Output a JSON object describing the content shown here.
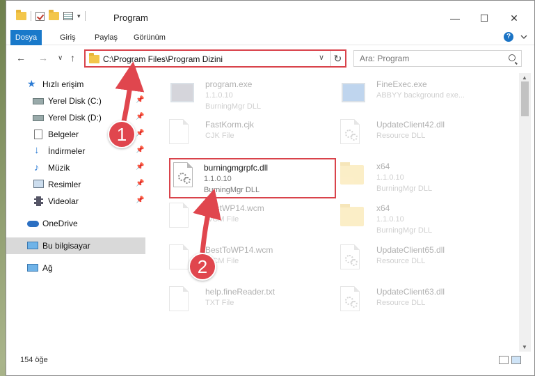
{
  "window": {
    "title": "Program",
    "minimize": "—",
    "maximize": "☐",
    "close": "✕"
  },
  "ribbon": {
    "tabs": [
      "Dosya",
      "Giriş",
      "Paylaş",
      "Görünüm"
    ],
    "help": "?"
  },
  "address": {
    "path": "C:\\Program Files\\Program Dizini",
    "dropdown": "∨",
    "refresh": "↻"
  },
  "search": {
    "placeholder": "Ara: Program"
  },
  "nav": {
    "back": "←",
    "forward": "→",
    "recent": "∨",
    "up": "↑",
    "items": [
      {
        "label": "Hızlı erişim",
        "icon": "star-icon"
      },
      {
        "label": "Yerel Disk (C:)",
        "icon": "drive-icon",
        "pinned": true
      },
      {
        "label": "Yerel Disk (D:)",
        "icon": "drive-icon",
        "pinned": true
      },
      {
        "label": "Belgeler",
        "icon": "documents-icon",
        "pinned": true
      },
      {
        "label": "İndirmeler",
        "icon": "download-icon",
        "pinned": true
      },
      {
        "label": "Müzik",
        "icon": "music-icon",
        "pinned": true
      },
      {
        "label": "Resimler",
        "icon": "pictures-icon",
        "pinned": true
      },
      {
        "label": "Videolar",
        "icon": "video-icon",
        "pinned": true
      },
      {
        "label": "OneDrive",
        "icon": "cloud-icon"
      },
      {
        "label": "Bu bilgisayar",
        "icon": "computer-icon",
        "selected": true
      },
      {
        "label": "Ağ",
        "icon": "network-icon"
      }
    ]
  },
  "files": [
    {
      "name": "program.exe",
      "line2": "1.1.0.10",
      "line3": "BurningMgr DLL",
      "icon": "exe-icon"
    },
    {
      "name": "FineExec.exe",
      "line2": "ABBYY background exe...",
      "line3": "",
      "icon": "exe-icon"
    },
    {
      "name": "FastKorm.cjk",
      "line2": "CJK File",
      "line3": "",
      "icon": "file-icon"
    },
    {
      "name": "UpdateClient42.dll",
      "line2": "Resource DLL",
      "line3": "",
      "icon": "dll-icon"
    },
    {
      "name": "burningmgrpfc.dll",
      "line2": "1.1.0.10",
      "line3": "BurningMgr DLL",
      "icon": "dll-icon"
    },
    {
      "name": "x64",
      "line2": "1.1.0.10",
      "line3": "BurningMgr DLL",
      "icon": "folder-icon"
    },
    {
      "name": "BestWP14.wcm",
      "line2": "WCM File",
      "line3": "",
      "icon": "file-icon"
    },
    {
      "name": "x64",
      "line2": "1.1.0.10",
      "line3": "BurningMgr DLL",
      "icon": "folder-icon"
    },
    {
      "name": "BestToWP14.wcm",
      "line2": "WCM File",
      "line3": "",
      "icon": "file-icon"
    },
    {
      "name": "UpdateClient65.dll",
      "line2": "Resource DLL",
      "line3": "",
      "icon": "dll-icon"
    },
    {
      "name": "help.fineReader.txt",
      "line2": "TXT File",
      "line3": "",
      "icon": "file-icon"
    },
    {
      "name": "UpdateClient63.dll",
      "line2": "Resource DLL",
      "line3": "",
      "icon": "dll-icon"
    }
  ],
  "status": {
    "count": "154 öğe"
  },
  "annotations": {
    "step1": "1",
    "step2": "2"
  },
  "colors": {
    "accent": "#1979ca",
    "highlight": "#d9434b",
    "selected": "#d9d9d9"
  }
}
